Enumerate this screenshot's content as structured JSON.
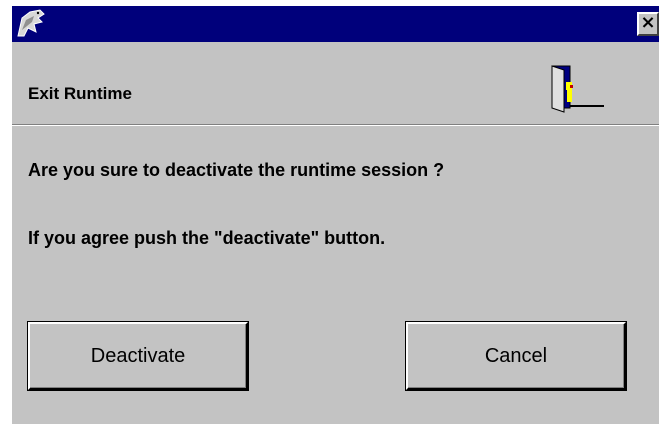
{
  "window": {
    "title_bar_color": "#00007b",
    "close_glyph": "×",
    "app_icon": "gecko-icon"
  },
  "header": {
    "title": "Exit Runtime",
    "icon": "exit-door-icon"
  },
  "message": {
    "line1": "Are you sure to deactivate the runtime session ?",
    "line2": "If you agree push the \"deactivate\" button."
  },
  "buttons": {
    "deactivate_label": "Deactivate",
    "cancel_label": "Cancel"
  }
}
